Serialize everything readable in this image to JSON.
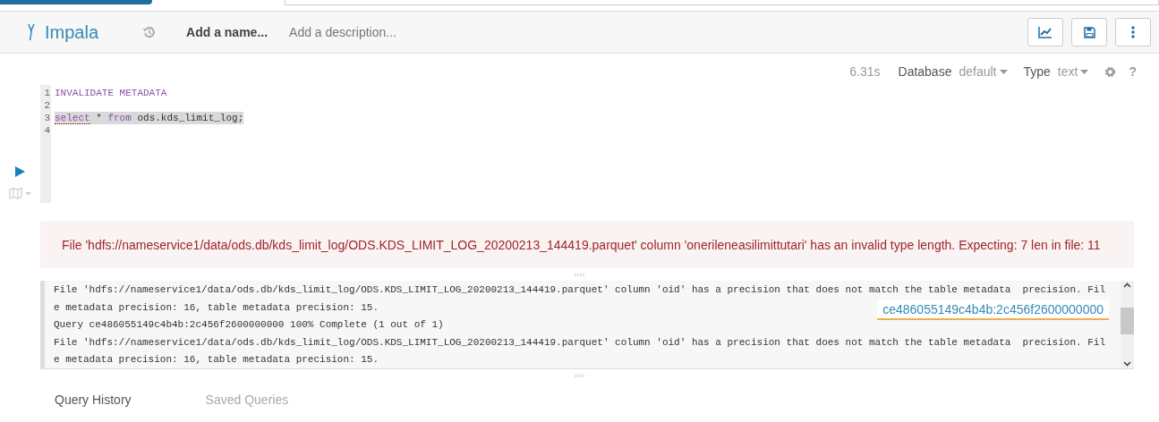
{
  "header": {
    "app": "Impala",
    "name_placeholder": "Add a name...",
    "description_placeholder": "Add a description..."
  },
  "toolbar": {
    "elapsed": "6.31s",
    "database_label": "Database",
    "database": "default",
    "type_label": "Type",
    "type": "text",
    "help": "?"
  },
  "editor": {
    "lines": [
      {
        "number": "1",
        "selected": false,
        "tokens": [
          {
            "text": "INVALIDATE METADATA",
            "kind": "keyword"
          }
        ]
      },
      {
        "number": "2",
        "selected": false
      },
      {
        "number": "3",
        "selected": true,
        "tokens": [
          {
            "text": "select",
            "kind": "keyword-flagged"
          },
          {
            "text": " * ",
            "kind": "plain"
          },
          {
            "text": "from",
            "kind": "keyword"
          },
          {
            "text": " ods.kds_limit_log;",
            "kind": "plain"
          }
        ]
      },
      {
        "number": "4",
        "selected": false
      }
    ]
  },
  "error": "File 'hdfs://nameservice1/data/ods.db/kds_limit_log/ODS.KDS_LIMIT_LOG_20200213_144419.parquet' column 'onerileneasilimittutari' has an invalid type length. Expecting: 7 len in file: 11",
  "log": {
    "lines": [
      "File 'hdfs://nameservice1/data/ods.db/kds_limit_log/ODS.KDS_LIMIT_LOG_20200213_144419.parquet' column 'oid' has a precision that does not match the table metadata  precision. Fil",
      "e metadata precision: 16, table metadata precision: 15.",
      "Query ce486055149c4b4b:2c456f2600000000 100% Complete (1 out of 1)",
      "File 'hdfs://nameservice1/data/ods.db/kds_limit_log/ODS.KDS_LIMIT_LOG_20200213_144419.parquet' column 'oid' has a precision that does not match the table metadata  precision. Fil",
      "e metadata precision: 16, table metadata precision: 15."
    ],
    "tooltip": "ce486055149c4b4b:2c456f2600000000"
  },
  "tabs": [
    {
      "label": "Query History",
      "selected": true
    },
    {
      "label": "Saved Queries",
      "selected": false
    }
  ]
}
